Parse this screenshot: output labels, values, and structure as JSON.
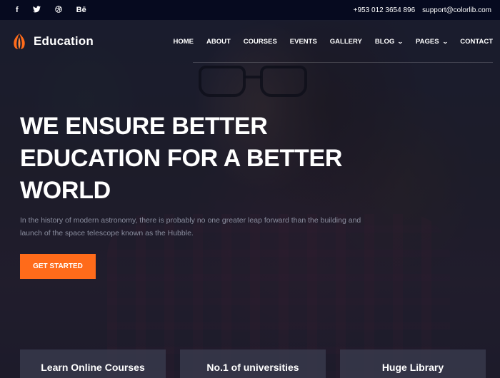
{
  "topbar": {
    "social": [
      {
        "icon": "facebook-icon",
        "glyph": "f"
      },
      {
        "icon": "twitter-icon",
        "glyph": "🐦"
      },
      {
        "icon": "dribbble-icon",
        "glyph": "◎"
      },
      {
        "icon": "behance-icon",
        "glyph": "Bē"
      }
    ],
    "phone": "+953 012 3654 896",
    "email": "support@colorlib.com"
  },
  "brand": {
    "name": "Education",
    "accent": "#ff6b1a"
  },
  "nav": {
    "items": [
      {
        "label": "HOME",
        "dropdown": false
      },
      {
        "label": "ABOUT",
        "dropdown": false
      },
      {
        "label": "COURSES",
        "dropdown": false
      },
      {
        "label": "EVENTS",
        "dropdown": false
      },
      {
        "label": "GALLERY",
        "dropdown": false
      },
      {
        "label": "BLOG",
        "dropdown": true
      },
      {
        "label": "PAGES",
        "dropdown": true
      },
      {
        "label": "CONTACT",
        "dropdown": false
      }
    ]
  },
  "hero": {
    "title_lines": [
      "WE ENSURE BETTER",
      "EDUCATION FOR A BETTER",
      "WORLD"
    ],
    "description": "In the history of modern astronomy, there is probably no one greater leap forward than the building and launch of the space telescope known as the Hubble.",
    "cta_label": "GET STARTED"
  },
  "features": [
    {
      "label": "Learn Online Courses"
    },
    {
      "label": "No.1 of universities"
    },
    {
      "label": "Huge Library"
    }
  ]
}
